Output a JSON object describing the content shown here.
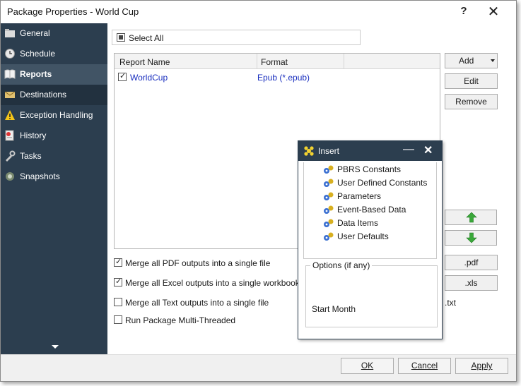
{
  "window": {
    "title": "Package Properties - World Cup",
    "help": "?",
    "close": "✕"
  },
  "sidebar": {
    "items": [
      {
        "label": "General",
        "icon": "folder-icon"
      },
      {
        "label": "Schedule",
        "icon": "clock-icon"
      },
      {
        "label": "Reports",
        "icon": "book-icon"
      },
      {
        "label": "Destinations",
        "icon": "envelope-icon"
      },
      {
        "label": "Exception Handling",
        "icon": "warning-icon"
      },
      {
        "label": "History",
        "icon": "history-icon"
      },
      {
        "label": "Tasks",
        "icon": "tasks-icon"
      },
      {
        "label": "Snapshots",
        "icon": "camera-icon"
      }
    ],
    "active": "Reports"
  },
  "main": {
    "select_all": "Select All",
    "list": {
      "columns": [
        "Report Name",
        "Format"
      ],
      "rows": [
        {
          "name": "WorldCup",
          "format": "Epub (*.epub)",
          "checked": true
        }
      ]
    },
    "buttons": {
      "add": "Add",
      "edit": "Edit",
      "remove": "Remove",
      "pdf": ".pdf",
      "xls": ".xls",
      "txt": ".txt"
    },
    "options": [
      {
        "label": "Merge all PDF outputs into a single file",
        "checked": true
      },
      {
        "label": "Merge all Excel outputs into a single workbook",
        "checked": true
      },
      {
        "label": "Merge all Text outputs into a single file",
        "checked": false
      },
      {
        "label": "Run Package Multi-Threaded",
        "checked": false
      }
    ]
  },
  "insert": {
    "title": "Insert",
    "items": [
      "PBRS Constants",
      "User Defined Constants",
      "Parameters",
      "Event-Based Data",
      "Data Items",
      "User Defaults"
    ],
    "options_legend": "Options (if any)",
    "options_value": "Start Month"
  },
  "footer": {
    "ok": "OK",
    "cancel": "Cancel",
    "apply": "Apply"
  },
  "colors": {
    "sidebar": "#2c3e4f",
    "active": "#415465",
    "link": "#1a2fbf",
    "arrow": "#3aa83a"
  }
}
